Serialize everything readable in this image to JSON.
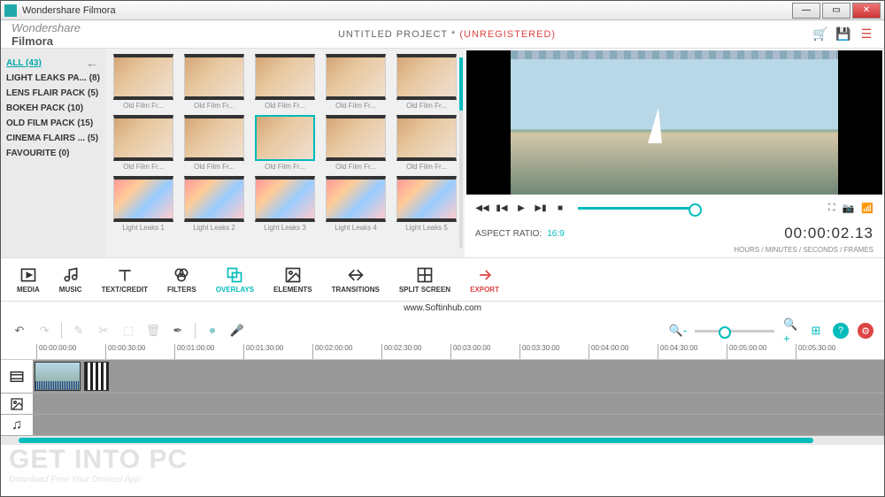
{
  "window": {
    "title": "Wondershare Filmora"
  },
  "header": {
    "logo_small": "Wondershare",
    "logo_main": "Filmora",
    "project": "UNTITLED PROJECT *",
    "status": "(UNREGISTERED)"
  },
  "sidebar": {
    "items": [
      {
        "label": "ALL (43)",
        "selected": true
      },
      {
        "label": "LIGHT LEAKS PA...  (8)"
      },
      {
        "label": "LENS FLAIR PACK (5)"
      },
      {
        "label": "BOKEH PACK (10)"
      },
      {
        "label": "OLD FILM PACK (15)"
      },
      {
        "label": "CINEMA FLAIRS ...  (5)"
      },
      {
        "label": "FAVOURITE (0)"
      }
    ]
  },
  "thumbs": {
    "rows": [
      [
        {
          "label": "Old Film Fr..."
        },
        {
          "label": "Old Film Fr..."
        },
        {
          "label": "Old Film Fr..."
        },
        {
          "label": "Old Film Fr..."
        },
        {
          "label": "Old Film Fr..."
        }
      ],
      [
        {
          "label": "Old Film Fr..."
        },
        {
          "label": "Old Film Fr..."
        },
        {
          "label": "Old Film Fr...",
          "selected": true
        },
        {
          "label": "Old Film Fr..."
        },
        {
          "label": "Old Film Fr..."
        }
      ],
      [
        {
          "label": "Light Leaks 1",
          "leak": true
        },
        {
          "label": "Light Leaks 2",
          "leak": true
        },
        {
          "label": "Light Leaks 3",
          "leak": true
        },
        {
          "label": "Light Leaks 4",
          "leak": true
        },
        {
          "label": "Light Leaks 5",
          "leak": true
        }
      ]
    ]
  },
  "preview": {
    "aspect_label": "ASPECT RATIO:",
    "aspect_value": "16:9",
    "timecode": "00:00:02.13",
    "timecode_sub": "HOURS / MINUTES / SECONDS / FRAMES"
  },
  "tooltabs": [
    {
      "id": "media",
      "label": "MEDIA"
    },
    {
      "id": "music",
      "label": "MUSIC"
    },
    {
      "id": "text",
      "label": "TEXT/CREDIT"
    },
    {
      "id": "filters",
      "label": "FILTERS"
    },
    {
      "id": "overlays",
      "label": "OVERLAYS",
      "active": true
    },
    {
      "id": "elements",
      "label": "ELEMENTS"
    },
    {
      "id": "transitions",
      "label": "TRANSITIONS"
    },
    {
      "id": "split",
      "label": "SPLIT SCREEN"
    },
    {
      "id": "export",
      "label": "EXPORT",
      "export": true
    }
  ],
  "watermark_url": "www.Softinhub.com",
  "ruler": [
    "00:00:00:00",
    "00:00:30:00",
    "00:01:00:00",
    "00:01:30:00",
    "00:02:00:00",
    "00:02:30:00",
    "00:03:00:00",
    "00:03:30:00",
    "00:04:00:00",
    "00:04:30:00",
    "00:05:00:00",
    "00:05:30:00"
  ],
  "overlay": {
    "big": "GET INTO PC",
    "small": "Download Free Your Desired App"
  }
}
